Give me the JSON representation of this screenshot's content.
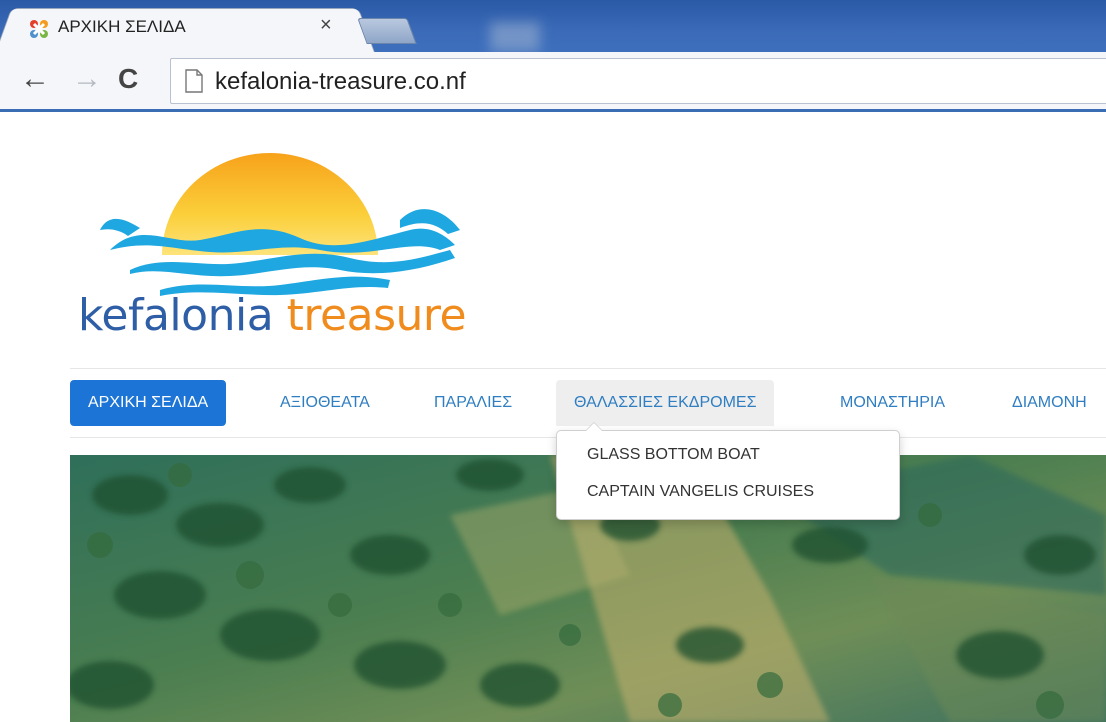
{
  "browser": {
    "tab": {
      "title": "ΑΡΧΙΚΗ ΣΕΛΙΔΑ",
      "favicon": "joomla-icon",
      "close_glyph": "×"
    },
    "toolbar": {
      "back_glyph": "←",
      "forward_glyph": "→",
      "reload_glyph": "C",
      "url": "kefalonia-treasure.co.nf"
    }
  },
  "site": {
    "logo": {
      "word1": "kefalonia",
      "word2": "treasure"
    },
    "nav": {
      "items": [
        {
          "label": "ΑΡΧΙΚΗ ΣΕΛΙΔΑ",
          "state": "active"
        },
        {
          "label": "ΑΞΙΟΘΕΑΤΑ",
          "state": "normal"
        },
        {
          "label": "ΠΑΡΑΛΙΕΣ",
          "state": "normal"
        },
        {
          "label": "ΘΑΛΑΣΣΙΕΣ ΕΚΔΡΟΜΕΣ",
          "state": "hover"
        },
        {
          "label": "ΜΟΝΑΣΤΗΡΙΑ",
          "state": "normal"
        },
        {
          "label": "ΔΙΑΜΟΝΗ",
          "state": "normal"
        }
      ],
      "dropdown": [
        "GLASS BOTTOM BOAT",
        "CAPTAIN VANGELIS CRUISES"
      ]
    }
  },
  "colors": {
    "active_nav": "#1b74d6",
    "nav_link": "#2f7ec2",
    "logo_blue": "#2e5ea6",
    "logo_orange": "#f08c1e"
  }
}
